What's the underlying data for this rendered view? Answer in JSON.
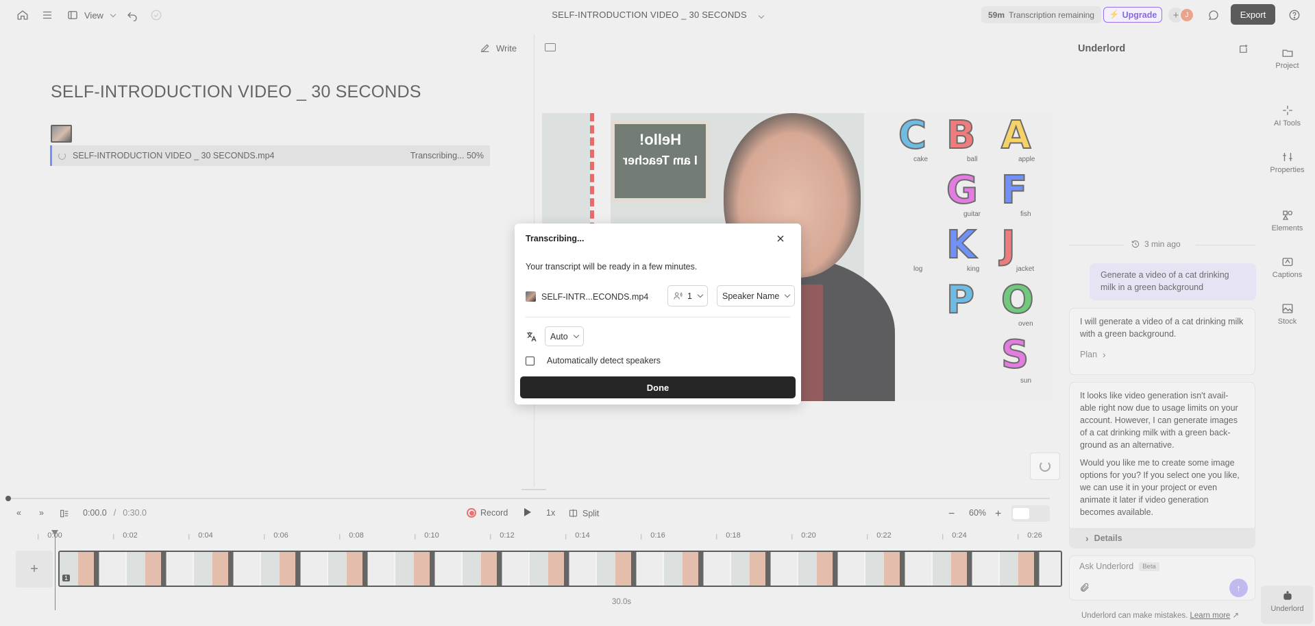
{
  "topbar": {
    "view_label": "View",
    "doc_title": "SELF-INTRODUCTION VIDEO _ 30 SECONDS",
    "remaining_amount": "59m",
    "remaining_label": "Transcription remaining",
    "upgrade_label": "Upgrade",
    "avatar_initial": "J",
    "export_label": "Export"
  },
  "script": {
    "write_label": "Write",
    "title": "SELF-INTRODUCTION VIDEO _ 30 SECONDS",
    "file_name": "SELF-INTRODUCTION VIDEO _ 30 SECONDS.mp4",
    "file_status": "Transcribing... 50%"
  },
  "video": {
    "board_text_1": "Hello!",
    "board_text_2": "I am Teacher",
    "words": [
      "apple",
      "ball",
      "cake",
      "fish",
      "guitar",
      "jacket",
      "king",
      "log",
      "oven",
      "sun"
    ]
  },
  "transport": {
    "current_time": "0:00.0",
    "separator": "/",
    "total_time": "0:30.0",
    "record_label": "Record",
    "speed_label": "1x",
    "split_label": "Split",
    "zoom_level": "60%"
  },
  "timeline": {
    "ticks": [
      "0:00",
      "0:02",
      "0:04",
      "0:06",
      "0:08",
      "0:10",
      "0:12",
      "0:14",
      "0:16",
      "0:18",
      "0:20",
      "0:22",
      "0:24",
      "0:26"
    ],
    "track_badge": "1",
    "duration": "30.0s"
  },
  "underlord": {
    "title": "Underlord",
    "timestamp": "3 min ago",
    "user_message": "Generate a video of a cat drinking milk in a green background",
    "reply_1": "I will generate a video of a cat drinking milk with a green background.",
    "plan_label": "Plan",
    "reply_2_p1": "It looks like video generation isn't avail-able right now due to usage limits on your account. However, I can generate images of a cat drinking milk with a green back-ground as an alternative.",
    "reply_2_p2": "Would you like me to create some image options for you? If you select one you like, we can use it in your project or even animate it later if video generation becomes available.",
    "details_label": "Details",
    "ask_placeholder": "Ask Underlord",
    "beta_label": "Beta",
    "disclaimer": "Underlord can make mistakes.",
    "learn_more": "Learn more"
  },
  "rail": {
    "items": [
      "Project",
      "AI Tools",
      "Properties",
      "Elements",
      "Captions",
      "Stock",
      "Underlord"
    ]
  },
  "dialog": {
    "title": "Transcribing...",
    "message": "Your transcript will be ready in a few minutes.",
    "file_name": "SELF-INTR...ECONDS.mp4",
    "speaker_count": "1",
    "speaker_name": "Speaker Name",
    "language": "Auto",
    "detect_label": "Automatically detect speakers",
    "done_label": "Done"
  }
}
